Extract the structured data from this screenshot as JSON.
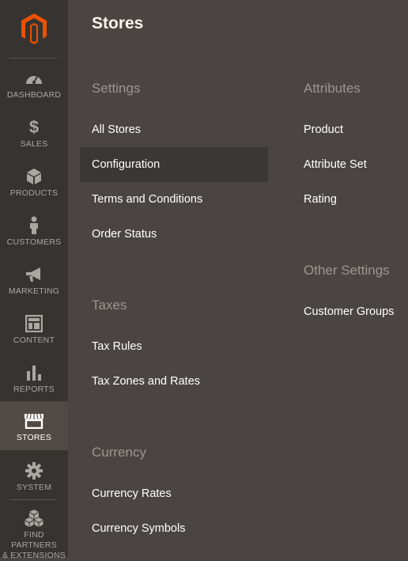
{
  "nav": {
    "items": [
      {
        "label": "DASHBOARD",
        "icon": "gauge-icon"
      },
      {
        "label": "SALES",
        "icon": "dollar-icon"
      },
      {
        "label": "PRODUCTS",
        "icon": "cube-icon"
      },
      {
        "label": "CUSTOMERS",
        "icon": "person-icon"
      },
      {
        "label": "MARKETING",
        "icon": "megaphone-icon"
      },
      {
        "label": "CONTENT",
        "icon": "layout-icon"
      },
      {
        "label": "REPORTS",
        "icon": "bar-chart-icon"
      },
      {
        "label": "STORES",
        "icon": "storefront-icon",
        "active": true
      },
      {
        "label": "SYSTEM",
        "icon": "gear-icon"
      },
      {
        "label": "FIND PARTNERS",
        "label2": "& EXTENSIONS",
        "icon": "blocks-icon"
      }
    ]
  },
  "panel": {
    "title": "Stores",
    "settings": {
      "heading": "Settings",
      "links": [
        "All Stores",
        "Configuration",
        "Terms and Conditions",
        "Order Status"
      ]
    },
    "taxes": {
      "heading": "Taxes",
      "links": [
        "Tax Rules",
        "Tax Zones and Rates"
      ]
    },
    "currency": {
      "heading": "Currency",
      "links": [
        "Currency Rates",
        "Currency Symbols"
      ]
    },
    "attributes": {
      "heading": "Attributes",
      "links": [
        "Product",
        "Attribute Set",
        "Rating"
      ]
    },
    "other": {
      "heading": "Other Settings",
      "links": [
        "Customer Groups"
      ]
    }
  },
  "colors": {
    "brand": "#eb5202",
    "panel_bg": "#4a4542",
    "nav_bg": "#373330",
    "active_nav_bg": "#514943"
  }
}
